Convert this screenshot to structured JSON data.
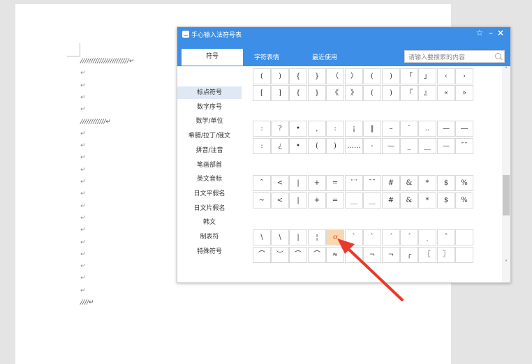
{
  "document": {
    "lines": [
      {
        "text": "///////////////////////↵",
        "kind": "slash"
      },
      {
        "text": "↵",
        "kind": "mark"
      },
      {
        "text": "↵",
        "kind": "mark"
      },
      {
        "text": "↵",
        "kind": "mark"
      },
      {
        "text": "↵",
        "kind": "mark"
      },
      {
        "text": "////////////↵",
        "kind": "slash"
      },
      {
        "text": "↵",
        "kind": "mark"
      },
      {
        "text": "↵",
        "kind": "mark"
      },
      {
        "text": "↵",
        "kind": "mark"
      },
      {
        "text": "↵",
        "kind": "mark"
      },
      {
        "text": "↵",
        "kind": "mark"
      },
      {
        "text": "↵",
        "kind": "mark"
      },
      {
        "text": "↵",
        "kind": "mark"
      },
      {
        "text": "↵",
        "kind": "mark"
      },
      {
        "text": "↵",
        "kind": "mark"
      },
      {
        "text": "↵",
        "kind": "mark"
      },
      {
        "text": "↵",
        "kind": "mark"
      },
      {
        "text": "↵",
        "kind": "mark"
      },
      {
        "text": "↵",
        "kind": "mark"
      },
      {
        "text": "↵",
        "kind": "mark"
      },
      {
        "text": "////↵",
        "kind": "slash"
      }
    ]
  },
  "symbol_panel": {
    "title": "手心输入法符号表",
    "pin_glyph": "☆",
    "minimize_glyph": "–",
    "close_glyph": "×",
    "tabs": [
      "符号",
      "字符表情",
      "最近使用"
    ],
    "search_placeholder": "请输入要搜索的内容",
    "categories": [
      "标点符号",
      "数字序号",
      "数学/单位",
      "希腊/拉丁/俄文",
      "拼音/注音",
      "笔画部首",
      "英文音标",
      "日文平假名",
      "日文片假名",
      "韩文",
      "制表符",
      "特殊符号"
    ],
    "active_category": "标点符号",
    "symbol_rows": [
      [
        "(",
        ")",
        "{",
        "}",
        "〈",
        "〉",
        "(",
        ")",
        "「",
        "」",
        "‹",
        "›"
      ],
      [
        "[",
        "]",
        "{",
        "}",
        "《",
        "》",
        "(",
        ")",
        "『",
        "』",
        "«",
        "»"
      ],
      [
        ":",
        "?",
        "•",
        ",",
        ":",
        "¡",
        "‖",
        "–",
        "¯",
        "‥",
        "—",
        "―"
      ],
      [
        ":",
        "¿",
        "•",
        "(",
        ")",
        "……",
        "-",
        "—",
        "_",
        "__",
        "—",
        "¯¯"
      ],
      [
        "˜",
        "<",
        "|",
        "+",
        "=",
        "¨¨",
        "¯¯",
        "#",
        "&",
        "*",
        "$",
        "%"
      ],
      [
        "~",
        "<",
        "|",
        "+",
        "=",
        "__",
        "__",
        "#",
        "&",
        "*",
        "$",
        "%"
      ],
      [
        "\\",
        "\\",
        "|",
        "¦",
        "ơ",
        "ˋ",
        "`",
        "ˊ",
        "ˊ",
        "ˎ",
        "ˆ",
        ""
      ],
      [
        "⌒",
        "︶",
        "⌒",
        "⌒",
        "≈",
        "",
        "¬",
        "¬",
        "╭",
        "〖",
        "〗",
        ""
      ]
    ],
    "selected_symbol": "ơ",
    "scroll_up_glyph": "˄",
    "scroll_down_glyph": "˅"
  },
  "annotation": {
    "arrow_color": "#e8392b"
  }
}
